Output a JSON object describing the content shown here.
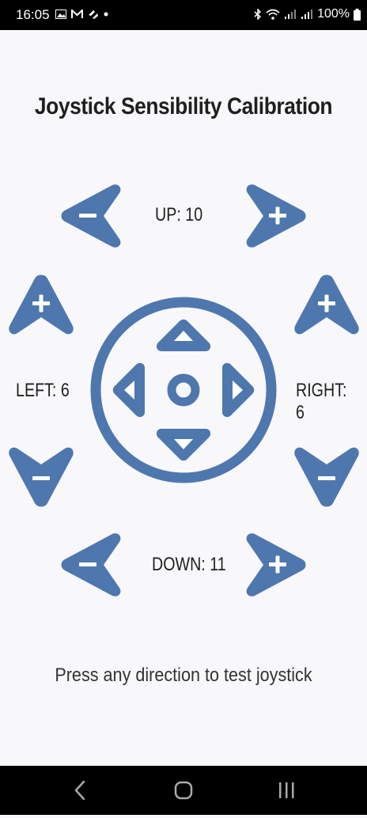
{
  "status_bar": {
    "time": "16:05",
    "battery": "100%",
    "icons_left": [
      "image-icon",
      "gmail-icon",
      "app-icon",
      "dot-icon"
    ],
    "icons_right": [
      "bluetooth-icon",
      "wifi-icon",
      "signal-icon",
      "signal-icon",
      "battery-icon"
    ]
  },
  "title": "Joystick Sensibility Calibration",
  "labels": {
    "up": "UP: 10",
    "down": "DOWN: 11",
    "left": "LEFT: 6",
    "right": "RIGHT: 6"
  },
  "hint": "Press any direction to test joystick",
  "colors": {
    "accent": "#4e77ae",
    "background": "#f8f7fa",
    "text": "#1f1f1f"
  },
  "nav_bar": {
    "icons": [
      "back-icon",
      "home-icon",
      "recents-icon"
    ]
  }
}
